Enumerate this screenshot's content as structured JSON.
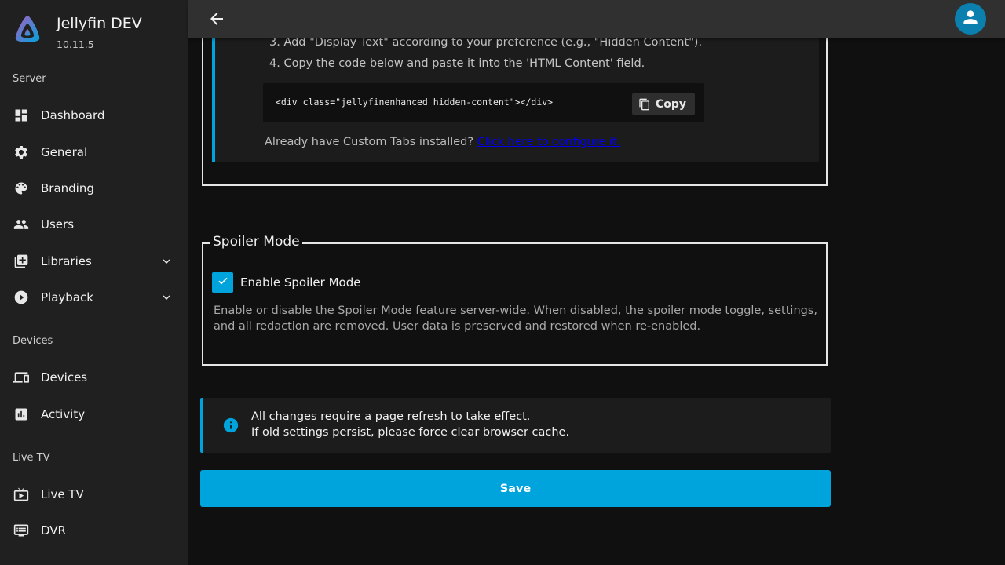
{
  "app": {
    "title": "Jellyfin DEV",
    "version": "10.11.5",
    "logo_icon": "jellyfin-logo-icon"
  },
  "sidebar": {
    "sections": {
      "server": "Server",
      "devices": "Devices",
      "livetv": "Live TV"
    },
    "items": [
      {
        "label": "Dashboard",
        "icon": "dashboard-icon"
      },
      {
        "label": "General",
        "icon": "gear-icon"
      },
      {
        "label": "Branding",
        "icon": "palette-icon"
      },
      {
        "label": "Users",
        "icon": "users-icon"
      },
      {
        "label": "Libraries",
        "icon": "library-add-icon",
        "expandable": true
      },
      {
        "label": "Playback",
        "icon": "play-circle-icon",
        "expandable": true
      },
      {
        "label": "Devices",
        "icon": "devices-icon"
      },
      {
        "label": "Activity",
        "icon": "activity-chart-icon"
      },
      {
        "label": "Live TV",
        "icon": "tv-icon"
      },
      {
        "label": "DVR",
        "icon": "dvr-icon"
      }
    ]
  },
  "header": {
    "back_icon": "arrow-back-icon",
    "avatar_icon": "user-icon"
  },
  "hidden_content": {
    "step3": "3. Add \"Display Text\" according to your preference (e.g., \"Hidden Content\").",
    "step4": "4. Copy the code below and paste it into the 'HTML Content' field.",
    "code": "<div class=\"jellyfinenhanced hidden-content\"></div>",
    "copy_label": "Copy",
    "already_text": "Already have Custom Tabs installed?",
    "configure_link": "Click here to configure it."
  },
  "spoiler": {
    "legend": "Spoiler Mode",
    "checkbox_label": "Enable Spoiler Mode",
    "checked": true,
    "description": "Enable or disable the Spoiler Mode feature server-wide. When disabled, the spoiler mode toggle, settings, and all redaction are removed. User data is preserved and restored when re-enabled."
  },
  "notice": {
    "line1": "All changes require a page refresh to take effect.",
    "line2": "If old settings persist, please force clear browser cache."
  },
  "save_label": "Save",
  "colors": {
    "accent": "#00a4dc",
    "background": "#101010",
    "sidebar": "#202020",
    "header": "#303030",
    "avatar": "#0b7fae"
  }
}
